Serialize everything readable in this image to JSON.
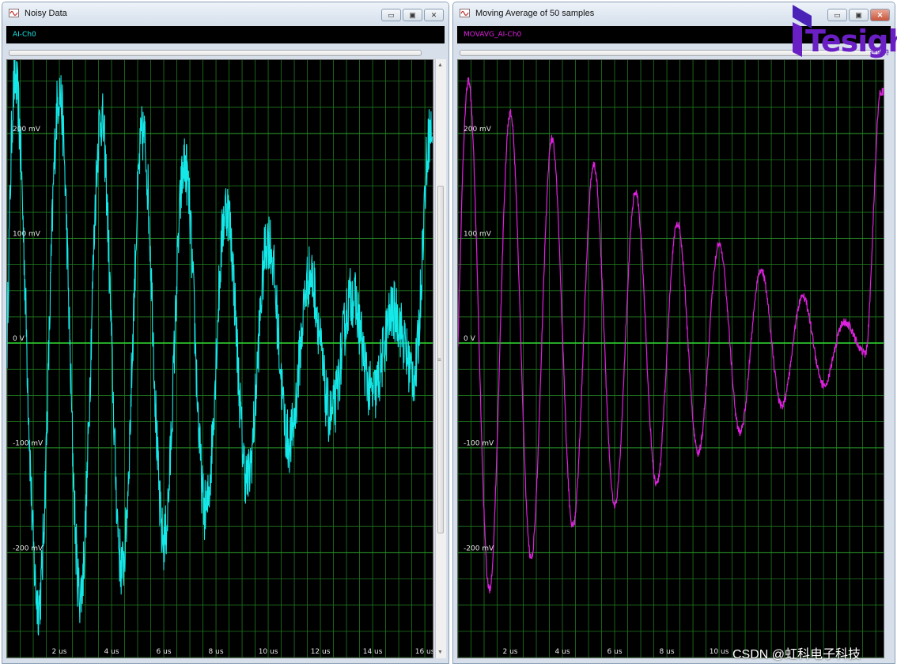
{
  "windows": [
    {
      "title": "Noisy Data",
      "channel_label": "AI-Ch0",
      "trace_color": "#14e8e8",
      "window_buttons": [
        "▭",
        "▣",
        "✕"
      ]
    },
    {
      "title": "Moving Average of 50 samples",
      "channel_label": "MOVAVG_AI-Ch0",
      "trace_color": "#e020e0",
      "window_buttons": [
        "▭",
        "▣",
        "✕"
      ]
    }
  ],
  "colors": {
    "plot_background": "#000000",
    "grid": "#1f7a1f",
    "zero_line": "#2fd02f",
    "axis_text": "#e6e6e6"
  },
  "logo": {
    "text": "Tesight",
    "subtitle": "德思特"
  },
  "watermark": "CSDN @虹科电子科技",
  "chart_data": [
    {
      "type": "line",
      "title": "",
      "xlabel": "",
      "ylabel": "",
      "x_unit": "us",
      "y_unit": "mV",
      "xlim": [
        0,
        16.3
      ],
      "ylim": [
        -300,
        270
      ],
      "x_ticks": [
        2,
        4,
        6,
        8,
        10,
        12,
        14,
        16
      ],
      "x_tick_labels": [
        "2 us",
        "4 us",
        "6 us",
        "8 us",
        "10 us",
        "12 us",
        "14 us",
        "16 us"
      ],
      "y_ticks": [
        200,
        100,
        0,
        -100,
        -200
      ],
      "y_tick_labels": [
        "200 mV",
        "100 mV",
        "0 V",
        "-100 mV",
        "-200 mV"
      ],
      "grid": true,
      "series": [
        {
          "color": "#14e8e8",
          "noise_mV": 30,
          "envelope_points": [
            {
              "x": 0.3,
              "y": 250
            },
            {
              "x": 1.2,
              "y": -250
            },
            {
              "x": 2.0,
              "y": 240
            },
            {
              "x": 2.8,
              "y": -240
            },
            {
              "x": 3.6,
              "y": 215
            },
            {
              "x": 4.4,
              "y": -215
            },
            {
              "x": 5.2,
              "y": 200
            },
            {
              "x": 6.0,
              "y": -190
            },
            {
              "x": 6.8,
              "y": 170
            },
            {
              "x": 7.6,
              "y": -160
            },
            {
              "x": 8.4,
              "y": 130
            },
            {
              "x": 9.2,
              "y": -130
            },
            {
              "x": 10.0,
              "y": 100
            },
            {
              "x": 10.8,
              "y": -95
            },
            {
              "x": 11.6,
              "y": 65
            },
            {
              "x": 12.4,
              "y": -70
            },
            {
              "x": 13.2,
              "y": 45
            },
            {
              "x": 14.0,
              "y": -50
            },
            {
              "x": 14.8,
              "y": 30
            },
            {
              "x": 15.6,
              "y": -30
            },
            {
              "x": 16.2,
              "y": 200
            }
          ]
        }
      ]
    },
    {
      "type": "line",
      "title": "",
      "xlabel": "",
      "ylabel": "",
      "x_unit": "us",
      "y_unit": "mV",
      "xlim": [
        0,
        16.3
      ],
      "ylim": [
        -300,
        270
      ],
      "x_ticks": [
        2,
        4,
        6,
        8,
        10
      ],
      "x_tick_labels": [
        "2 us",
        "4 us",
        "6 us",
        "8 us",
        "10 us"
      ],
      "y_ticks": [
        200,
        100,
        0,
        -100,
        -200
      ],
      "y_tick_labels": [
        "200 mV",
        "100 mV",
        "0 V",
        "-100 mV",
        "-200 mV"
      ],
      "grid": true,
      "series": [
        {
          "color": "#e020e0",
          "noise_mV": 4,
          "envelope_points": [
            {
              "x": 0.4,
              "y": 250
            },
            {
              "x": 1.2,
              "y": -235
            },
            {
              "x": 2.0,
              "y": 220
            },
            {
              "x": 2.8,
              "y": -205
            },
            {
              "x": 3.6,
              "y": 195
            },
            {
              "x": 4.4,
              "y": -175
            },
            {
              "x": 5.2,
              "y": 170
            },
            {
              "x": 6.0,
              "y": -155
            },
            {
              "x": 6.8,
              "y": 145
            },
            {
              "x": 7.6,
              "y": -135
            },
            {
              "x": 8.4,
              "y": 115
            },
            {
              "x": 9.2,
              "y": -105
            },
            {
              "x": 10.0,
              "y": 95
            },
            {
              "x": 10.8,
              "y": -85
            },
            {
              "x": 11.6,
              "y": 70
            },
            {
              "x": 12.4,
              "y": -60
            },
            {
              "x": 13.2,
              "y": 45
            },
            {
              "x": 14.0,
              "y": -40
            },
            {
              "x": 14.8,
              "y": 20
            },
            {
              "x": 15.6,
              "y": -10
            },
            {
              "x": 16.2,
              "y": 240
            }
          ]
        }
      ]
    }
  ]
}
